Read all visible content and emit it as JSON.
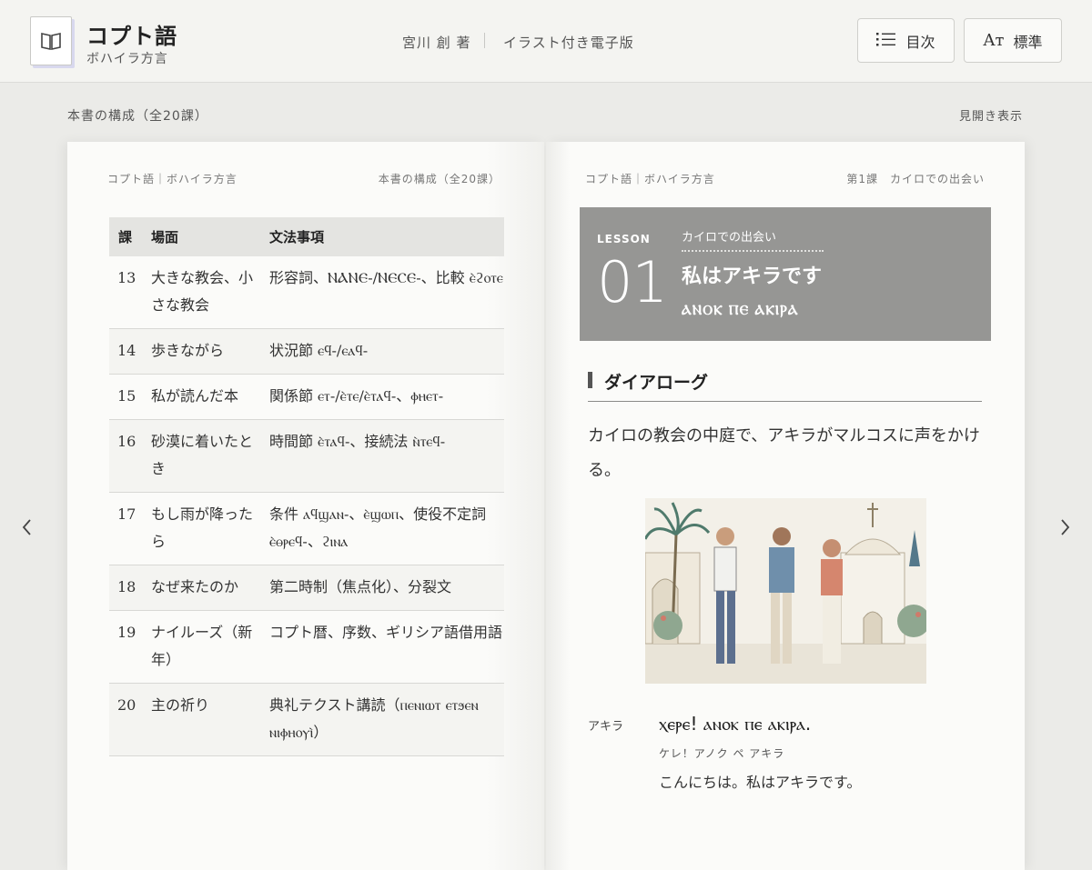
{
  "header": {
    "title": "コプト語",
    "subtitle": "ボハイラ方言",
    "author": "宮川 創 著",
    "edition": "イラスト付き電子版",
    "toc_button": "目次",
    "font_button_glyph": "Aт",
    "font_button": "標準"
  },
  "subheader": {
    "structure": "本書の構成（全20課）",
    "spread": "見開き表示"
  },
  "left_page": {
    "running_left": "コプト語｜ボハイラ方言",
    "running_right": "本書の構成（全20課）",
    "table": {
      "headers": [
        "課",
        "場面",
        "文法事項"
      ],
      "rows": [
        {
          "num": "13",
          "scene": "大きな教会、小さな教会",
          "grammar": "形容詞、ⲚⲀⲚⲈ-/ⲚⲈⲤⲈ-、比較 ⲉ̀ϩⲟⲧⲉ"
        },
        {
          "num": "14",
          "scene": "歩きながら",
          "grammar": "状況節 ⲉϥ-/ⲉⲁϥ-"
        },
        {
          "num": "15",
          "scene": "私が読んだ本",
          "grammar": "関係節 ⲉⲧ-/ⲉ̀ⲧⲉ/ⲉ̀ⲧⲁϥ-、ⲫⲏⲉⲧ-"
        },
        {
          "num": "16",
          "scene": "砂漠に着いたとき",
          "grammar": "時間節 ⲉ̀ⲧⲁϥ-、接続法 ⲛ̀ⲧⲉϥ-"
        },
        {
          "num": "17",
          "scene": "もし雨が降ったら",
          "grammar": "条件 ⲁϥϣⲁⲛ-、ⲉ̀ϣⲱⲡ、使役不定詞 ⲉ̀ⲑⲣⲉϥ-、ϩⲓⲛⲁ"
        },
        {
          "num": "18",
          "scene": "なぜ来たのか",
          "grammar": "第二時制（焦点化）、分裂文"
        },
        {
          "num": "19",
          "scene": "ナイルーズ（新年）",
          "grammar": "コプト暦、序数、ギリシア語借用語"
        },
        {
          "num": "20",
          "scene": "主の祈り",
          "grammar": "典礼テクスト講読（ⲡⲉⲛⲓⲱⲧ ⲉⲧϧⲉⲛ ⲛⲓⲫⲏⲟⲩⲓ̀）"
        }
      ]
    }
  },
  "right_page": {
    "running_left": "コプト語｜ボハイラ方言",
    "running_right": "第1課　カイロでの出会い",
    "lesson": {
      "label": "LESSON",
      "number": "01",
      "kicker": "カイロでの出会い",
      "title": "私はアキラです",
      "coptic": "ⲀⲚⲞⲔ ⲠⲈ ⲀⲔⲒⲢⲀ"
    },
    "section_title": "ダイアローグ",
    "intro": "カイロの教会の中庭で、アキラがマルコスに声をかける。",
    "dialogue": {
      "speaker": "アキラ",
      "coptic": "ⲭⲉⲣⲉ! ⲁⲛⲟⲕ ⲡⲉ ⲁⲕⲓⲣⲁ.",
      "reading": "ケレ！アノク ペ アキラ",
      "translation": "こんにちは。私はアキラです。"
    }
  },
  "colors": {
    "banner": "#969694",
    "page": "#fbfbf9",
    "background": "#ebebe8"
  }
}
